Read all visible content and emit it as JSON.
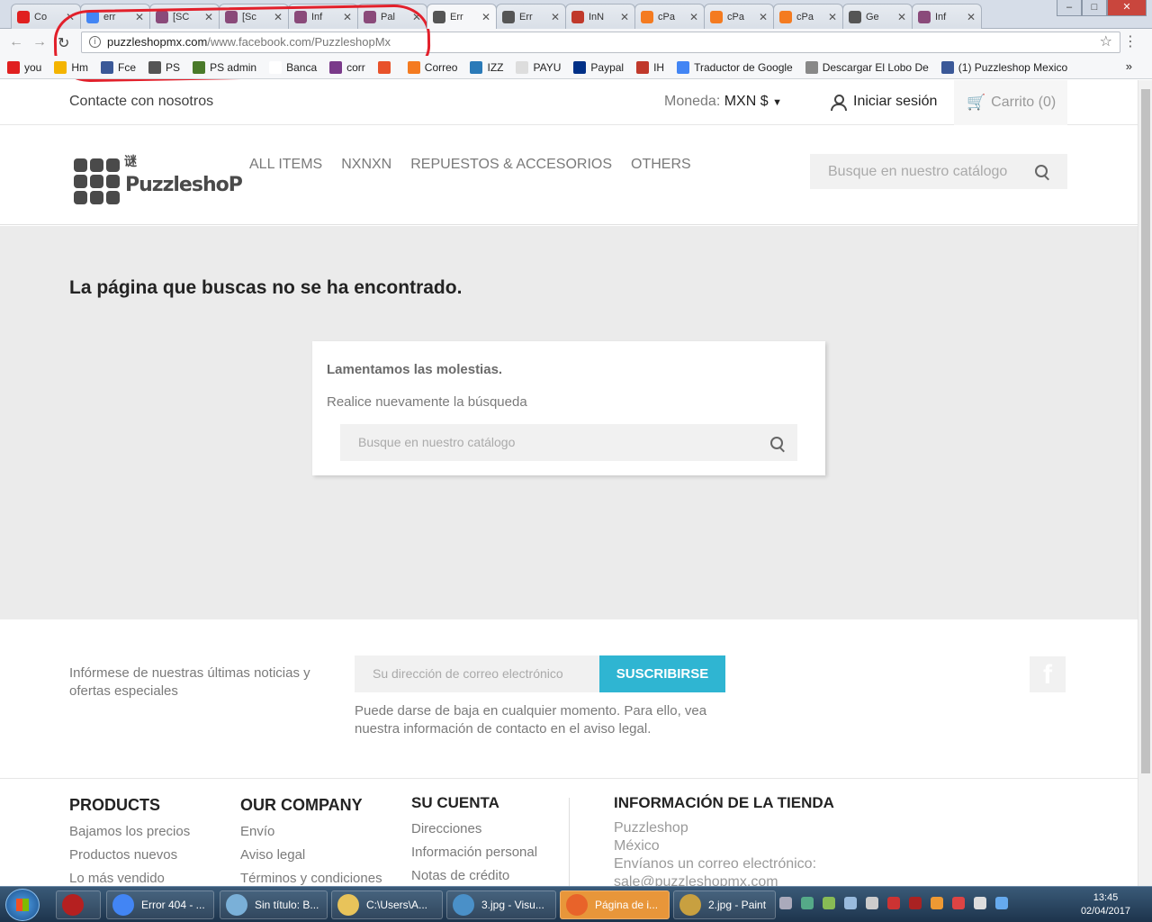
{
  "browser": {
    "tabs": [
      {
        "title": "Co",
        "color": "#e02020"
      },
      {
        "title": "err",
        "color": "#4285f4"
      },
      {
        "title": "[SC",
        "color": "#8a4a7a"
      },
      {
        "title": "[Sc",
        "color": "#8a4a7a"
      },
      {
        "title": "Inf",
        "color": "#8a4a7a"
      },
      {
        "title": "Pal",
        "color": "#8a4a7a"
      },
      {
        "title": "Err",
        "color": "#555555"
      },
      {
        "title": "Err",
        "color": "#555555"
      },
      {
        "title": "InN",
        "color": "#c0392b"
      },
      {
        "title": "cPa",
        "color": "#f47b20"
      },
      {
        "title": "cPa",
        "color": "#f47b20"
      },
      {
        "title": "cPa",
        "color": "#f47b20"
      },
      {
        "title": "Ge",
        "color": "#555555"
      },
      {
        "title": "Inf",
        "color": "#8a4a7a"
      }
    ],
    "url_domain": "puzzleshopmx.com",
    "url_path": "/www.facebook.com/PuzzleshopMx",
    "bookmarks": [
      {
        "label": "you",
        "color": "#e02020"
      },
      {
        "label": "Hm",
        "color": "#f4b400"
      },
      {
        "label": "Fce",
        "color": "#3b5998"
      },
      {
        "label": "PS",
        "color": "#555555"
      },
      {
        "label": "PS admin",
        "color": "#4a7a2a"
      },
      {
        "label": "Banca",
        "color": "#ffffff"
      },
      {
        "label": "corr",
        "color": "#7a3a8a"
      },
      {
        "label": "",
        "color": "#e8522a"
      },
      {
        "label": "Correo",
        "color": "#f47b20"
      },
      {
        "label": "IZZ",
        "color": "#2a7ab8"
      },
      {
        "label": "PAYU",
        "color": "#dddddd"
      },
      {
        "label": "Paypal",
        "color": "#003087"
      },
      {
        "label": "IH",
        "color": "#c0392b"
      },
      {
        "label": "Traductor de Google",
        "color": "#4285f4"
      },
      {
        "label": "Descargar El Lobo De",
        "color": "#888888"
      },
      {
        "label": "(1) Puzzleshop Mexico",
        "color": "#3b5998"
      }
    ]
  },
  "topnav": {
    "contact": "Contacte con nosotros",
    "currency_label": "Moneda:",
    "currency_value": "MXN $",
    "login": "Iniciar sesión",
    "cart": "Carrito (0)"
  },
  "header": {
    "logo_text": "PuzzleshoP",
    "logo_mark": "谜",
    "menu": [
      "ALL ITEMS",
      "NXNXN",
      "REPUESTOS & ACCESORIOS",
      "OTHERS"
    ],
    "search_placeholder": "Busque en nuestro catálogo"
  },
  "error": {
    "title": "La página que buscas no se ha encontrado.",
    "heading": "Lamentamos las molestias.",
    "text": "Realice nuevamente la búsqueda",
    "search_placeholder": "Busque en nuestro catálogo"
  },
  "newsletter": {
    "text": "Infórmese de nuestras últimas noticias y ofertas especiales",
    "placeholder": "Su dirección de correo electrónico",
    "button": "SUSCRIBIRSE",
    "note": "Puede darse de baja en cualquier momento. Para ello, vea nuestra información de contacto en el aviso legal.",
    "social_icon": "f"
  },
  "footer": {
    "products": {
      "title": "PRODUCTS",
      "links": [
        "Bajamos los precios",
        "Productos nuevos",
        "Lo más vendido"
      ]
    },
    "company": {
      "title": "OUR COMPANY",
      "links": [
        "Envío",
        "Aviso legal",
        "Términos y condiciones"
      ]
    },
    "account": {
      "title": "SU CUENTA",
      "links": [
        "Direcciones",
        "Información personal",
        "Notas de crédito"
      ]
    },
    "store": {
      "title": "INFORMACIÓN DE LA TIENDA",
      "lines": [
        "Puzzleshop",
        "México",
        "Envíanos un correo electrónico:",
        "sale@puzzleshopmx.com"
      ]
    }
  },
  "taskbar": {
    "apps": [
      {
        "label": "Error 404 - ...",
        "color": "#4285f4"
      },
      {
        "label": "Sin título: B...",
        "color": "#7ab0d8"
      },
      {
        "label": "C:\\Users\\A...",
        "color": "#e8c35a"
      },
      {
        "label": "3.jpg - Visu...",
        "color": "#4a90c8"
      },
      {
        "label": "Página de i...",
        "color": "#e8632a"
      },
      {
        "label": "2.jpg - Paint",
        "color": "#c8a040"
      }
    ],
    "time": "13:45",
    "date": "02/04/2017"
  }
}
